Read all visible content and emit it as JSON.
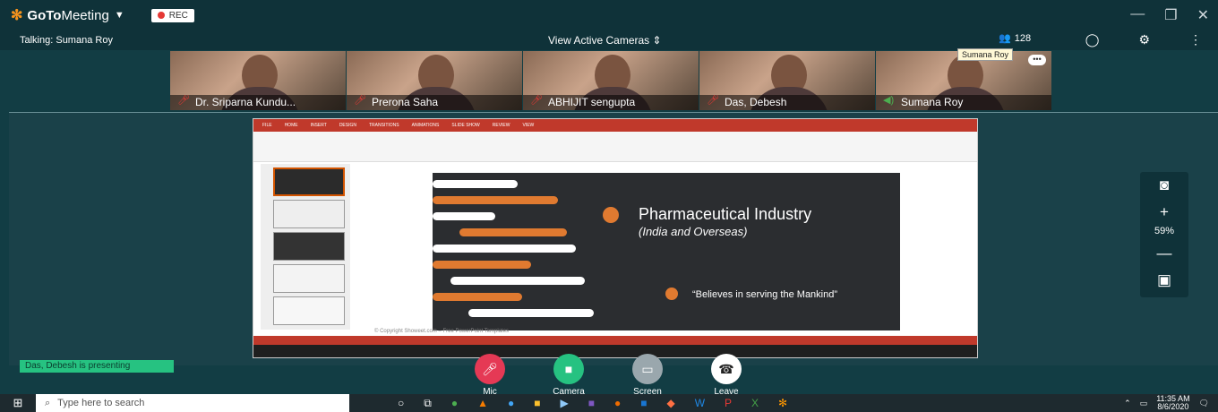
{
  "window": {
    "brand_go": "GoTo",
    "brand_meeting": "Meeting",
    "rec": "REC"
  },
  "infobar": {
    "talking": "Talking: Sumana Roy",
    "view_cameras": "View Active Cameras",
    "attendee_count": "128"
  },
  "cameras": [
    {
      "name": "Dr. Sriparna Kundu...",
      "muted": true
    },
    {
      "name": "Prerona Saha",
      "muted": true
    },
    {
      "name": "ABHIJIT sengupta",
      "muted": true
    },
    {
      "name": "Das, Debesh",
      "muted": true
    },
    {
      "name": "Sumana Roy",
      "muted": false
    }
  ],
  "tooltip": "Sumana Roy",
  "ppt": {
    "tabs": [
      "FILE",
      "HOME",
      "INSERT",
      "DESIGN",
      "TRANSITIONS",
      "ANIMATIONS",
      "SLIDE SHOW",
      "REVIEW",
      "VIEW"
    ],
    "slide_title": "Pharmaceutical Industry",
    "slide_subtitle": "(India and Overseas)",
    "slide_quote": "“Believes in serving the Mankind”",
    "copyright": "© Copyright Showeet.com – Free PowerPoint Templates"
  },
  "presenting": "Das, Debesh is presenting",
  "zoom": {
    "percent": "59%"
  },
  "controls": [
    {
      "label": "Mic",
      "color": "#e53955"
    },
    {
      "label": "Camera",
      "color": "#26c281"
    },
    {
      "label": "Screen",
      "color": "#9aa7ad"
    },
    {
      "label": "Leave",
      "color": "#ffffff"
    }
  ],
  "taskbar": {
    "search_placeholder": "Type here to search",
    "time": "11:35 AM",
    "date": "8/6/2020"
  }
}
